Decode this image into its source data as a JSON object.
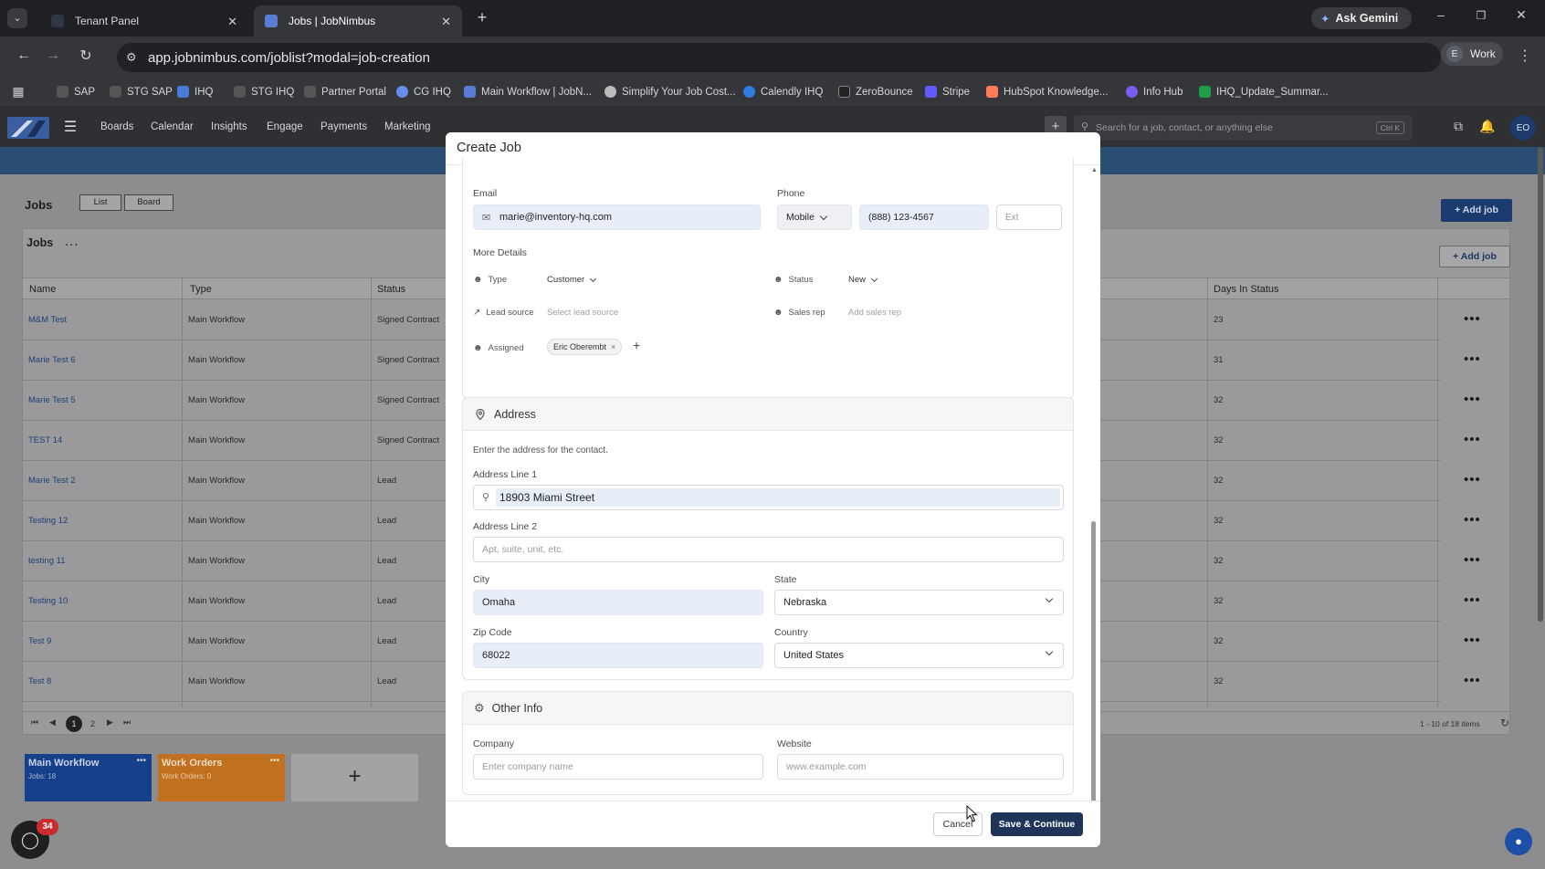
{
  "browser": {
    "tabs": [
      {
        "title": "Tenant Panel",
        "active": false
      },
      {
        "title": "Jobs | JobNimbus",
        "active": true
      }
    ],
    "ask_gemini": "Ask Gemini",
    "url": "app.jobnimbus.com/joblist?modal=job-creation",
    "profile_initial": "E",
    "profile_name": "Work",
    "bookmarks": [
      "SAP",
      "STG SAP",
      "IHQ",
      "STG IHQ",
      "Partner Portal",
      "CG IHQ",
      "Main Workflow | JobN...",
      "Simplify Your Job Cost...",
      "Calendly IHQ",
      "ZeroBounce",
      "Stripe",
      "HubSpot Knowledge...",
      "Info Hub",
      "IHQ_Update_Summar..."
    ]
  },
  "appnav": {
    "items": [
      "Boards",
      "Calendar",
      "Insights",
      "Engage",
      "Payments",
      "Marketing"
    ],
    "search_placeholder": "Search for a job, contact, or anything else",
    "shortcut": "Ctrl K",
    "avatar": "EO"
  },
  "jobs_page": {
    "title": "Jobs",
    "view_list": "List",
    "view_board": "Board",
    "add_job": "+ Add job",
    "panel_title": "Jobs",
    "panel_more": "...",
    "columns": [
      "Name",
      "Type",
      "Status",
      "Days In Status"
    ],
    "rows": [
      {
        "name": "M&M Test",
        "type": "Main Workflow",
        "status": "Signed Contract",
        "days": "23"
      },
      {
        "name": "Marie Test 6",
        "type": "Main Workflow",
        "status": "Signed Contract",
        "days": "31"
      },
      {
        "name": "Marie Test 5",
        "type": "Main Workflow",
        "status": "Signed Contract",
        "days": "32"
      },
      {
        "name": "TEST 14",
        "type": "Main Workflow",
        "status": "Signed Contract",
        "days": "32"
      },
      {
        "name": "Marie Test 2",
        "type": "Main Workflow",
        "status": "Lead",
        "days": "32"
      },
      {
        "name": "Testing 12",
        "type": "Main Workflow",
        "status": "Lead",
        "days": "32"
      },
      {
        "name": "testing 11",
        "type": "Main Workflow",
        "status": "Lead",
        "days": "32"
      },
      {
        "name": "Testing 10",
        "type": "Main Workflow",
        "status": "Lead",
        "days": "32"
      },
      {
        "name": "Test 9",
        "type": "Main Workflow",
        "status": "Lead",
        "days": "32"
      },
      {
        "name": "Test 8",
        "type": "Main Workflow",
        "status": "Lead",
        "days": "32"
      }
    ],
    "pagination": {
      "pages": [
        "1",
        "2"
      ],
      "current": "1",
      "summary": "1 - 10 of 18 items"
    },
    "workflows": [
      {
        "name": "Main Workflow",
        "sub": "Jobs: 18",
        "color": "#17408a"
      },
      {
        "name": "Work Orders",
        "sub": "Work Orders: 0",
        "color": "#c0701f"
      }
    ],
    "add_workflow": "+",
    "help_badge": "34"
  },
  "modal": {
    "title": "Create Job",
    "contact": {
      "email_label": "Email",
      "email_value": "marie@inventory-hq.com",
      "phone_label": "Phone",
      "phone_type": "Mobile",
      "phone_value": "(888) 123-4567",
      "ext_placeholder": "Ext",
      "more_details": "More Details",
      "type_label": "Type",
      "type_value": "Customer",
      "status_label": "Status",
      "status_value": "New",
      "lead_source_label": "Lead source",
      "lead_source_placeholder": "Select lead source",
      "sales_rep_label": "Sales rep",
      "sales_rep_placeholder": "Add sales rep",
      "assigned_label": "Assigned",
      "assigned_value": "Eric Oberembt",
      "assigned_remove": "×",
      "assigned_add": "+"
    },
    "address": {
      "title": "Address",
      "hint": "Enter the address for the contact.",
      "line1_label": "Address Line 1",
      "line1_value": "18903 Miami Street",
      "line2_label": "Address Line 2",
      "line2_placeholder": "Apt, suite, unit, etc.",
      "city_label": "City",
      "city_value": "Omaha",
      "state_label": "State",
      "state_value": "Nebraska",
      "zip_label": "Zip Code",
      "zip_value": "68022",
      "country_label": "Country",
      "country_value": "United States"
    },
    "other": {
      "title": "Other Info",
      "company_label": "Company",
      "company_placeholder": "Enter company name",
      "website_label": "Website",
      "website_placeholder": "www.example.com"
    },
    "cancel": "Cancel",
    "save": "Save & Continue"
  },
  "colors": {
    "primary": "#1f3459",
    "banner": "#2a4d73",
    "accent": "#1e4fa8"
  }
}
